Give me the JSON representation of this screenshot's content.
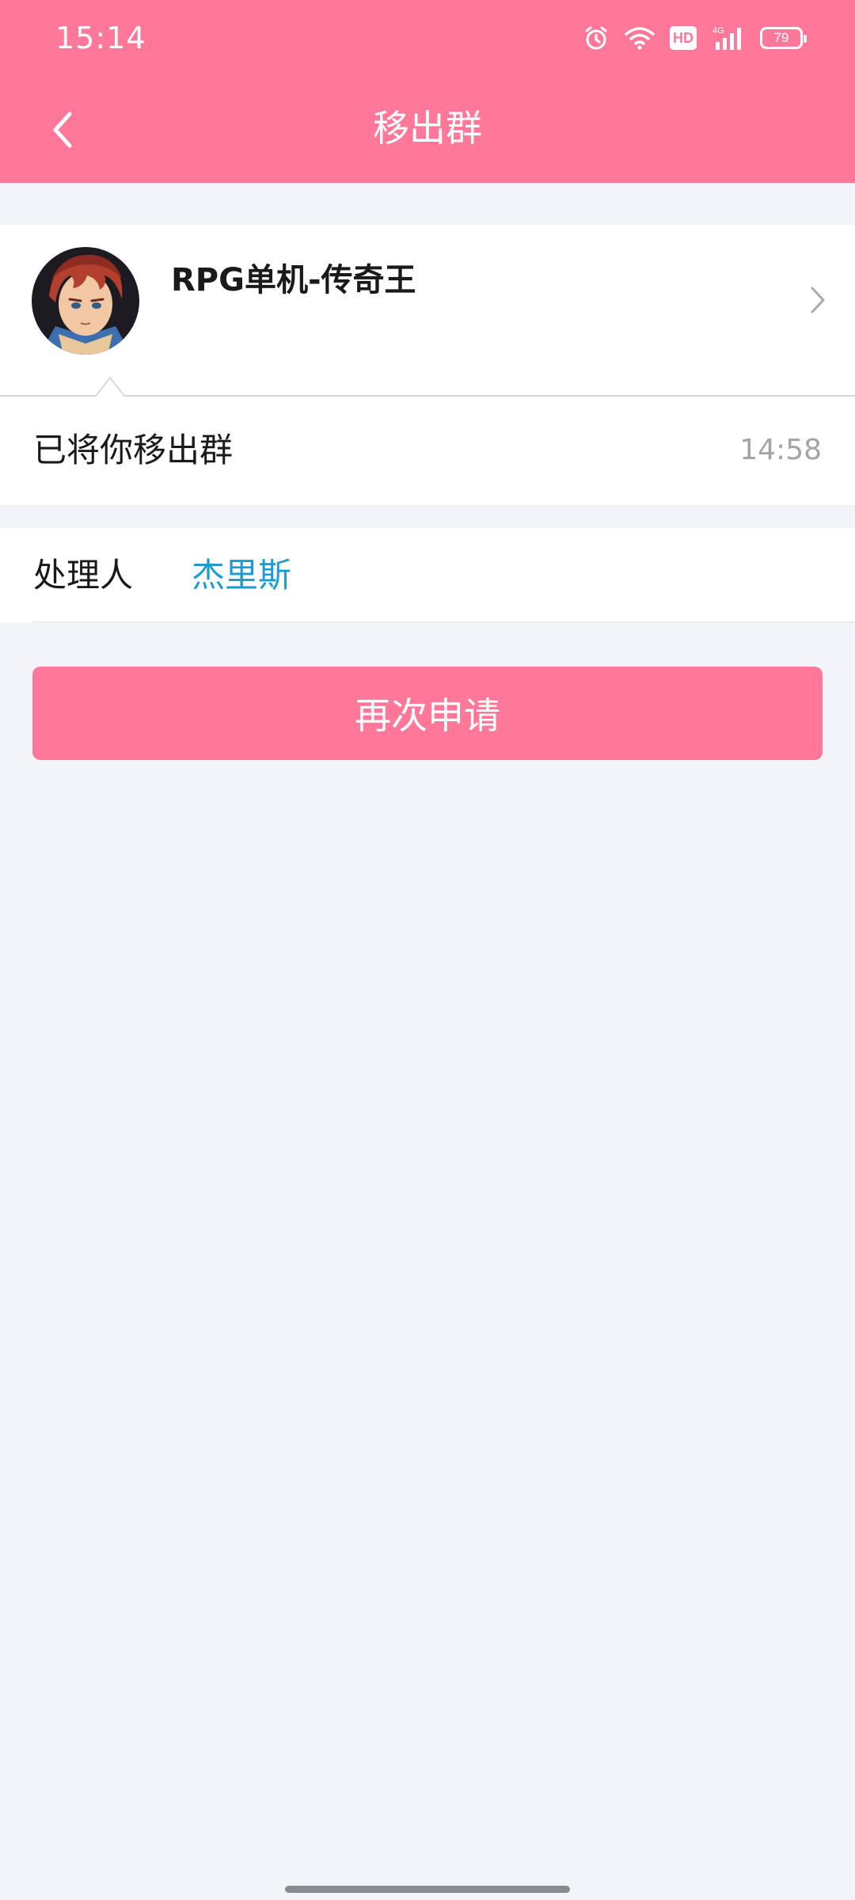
{
  "status_bar": {
    "time": "15:14",
    "hd_label": "HD",
    "network_label": "4G",
    "battery_level": "79"
  },
  "nav": {
    "title": "移出群"
  },
  "group": {
    "name": "RPG单机-传奇王"
  },
  "message": {
    "text": "已将你移出群",
    "time": "14:58"
  },
  "handler": {
    "label": "处理人",
    "name": "杰里斯"
  },
  "actions": {
    "reapply_label": "再次申请"
  },
  "colors": {
    "brand": "#ff7899",
    "link": "#1a9bd4",
    "background": "#f3f4f8"
  }
}
